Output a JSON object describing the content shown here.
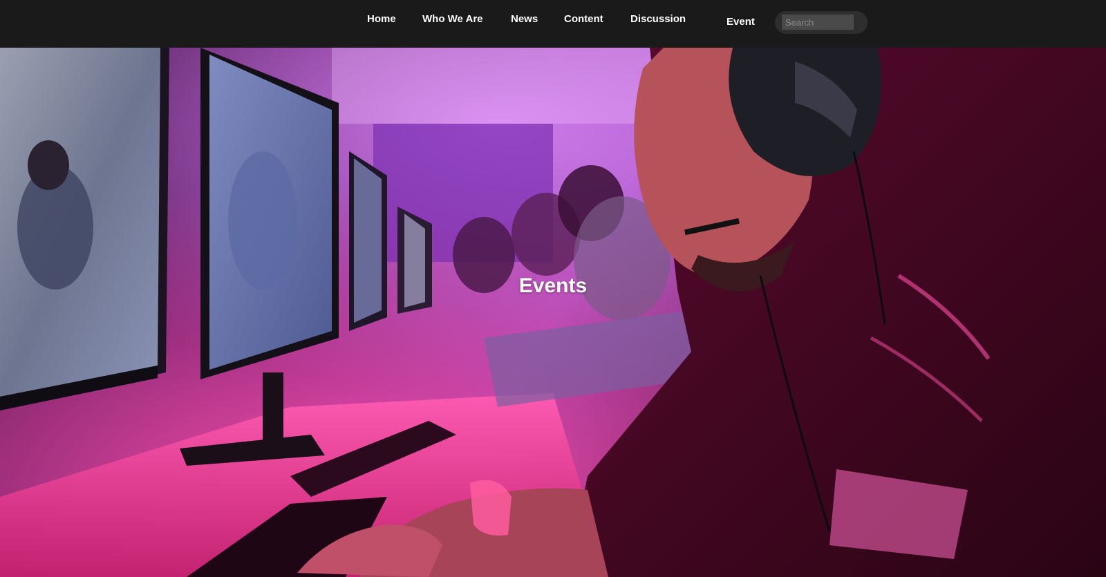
{
  "nav": {
    "items": [
      {
        "label": "Home"
      },
      {
        "label": "Who We Are"
      },
      {
        "label": "News"
      },
      {
        "label": "Content"
      },
      {
        "label": "Discussion"
      },
      {
        "label": "Event"
      }
    ],
    "search": {
      "placeholder": "Search",
      "value": ""
    }
  },
  "hero": {
    "title": "Events",
    "image_subject": "esports-gaming-arena-photo"
  },
  "colors": {
    "topbar": "#1a1a1a",
    "search_pill": "#2e2e2e",
    "search_field": "#4a4a4a",
    "accent_magenta": "#e0288a",
    "accent_purple": "#8e3aa8",
    "text": "#ffffff"
  }
}
